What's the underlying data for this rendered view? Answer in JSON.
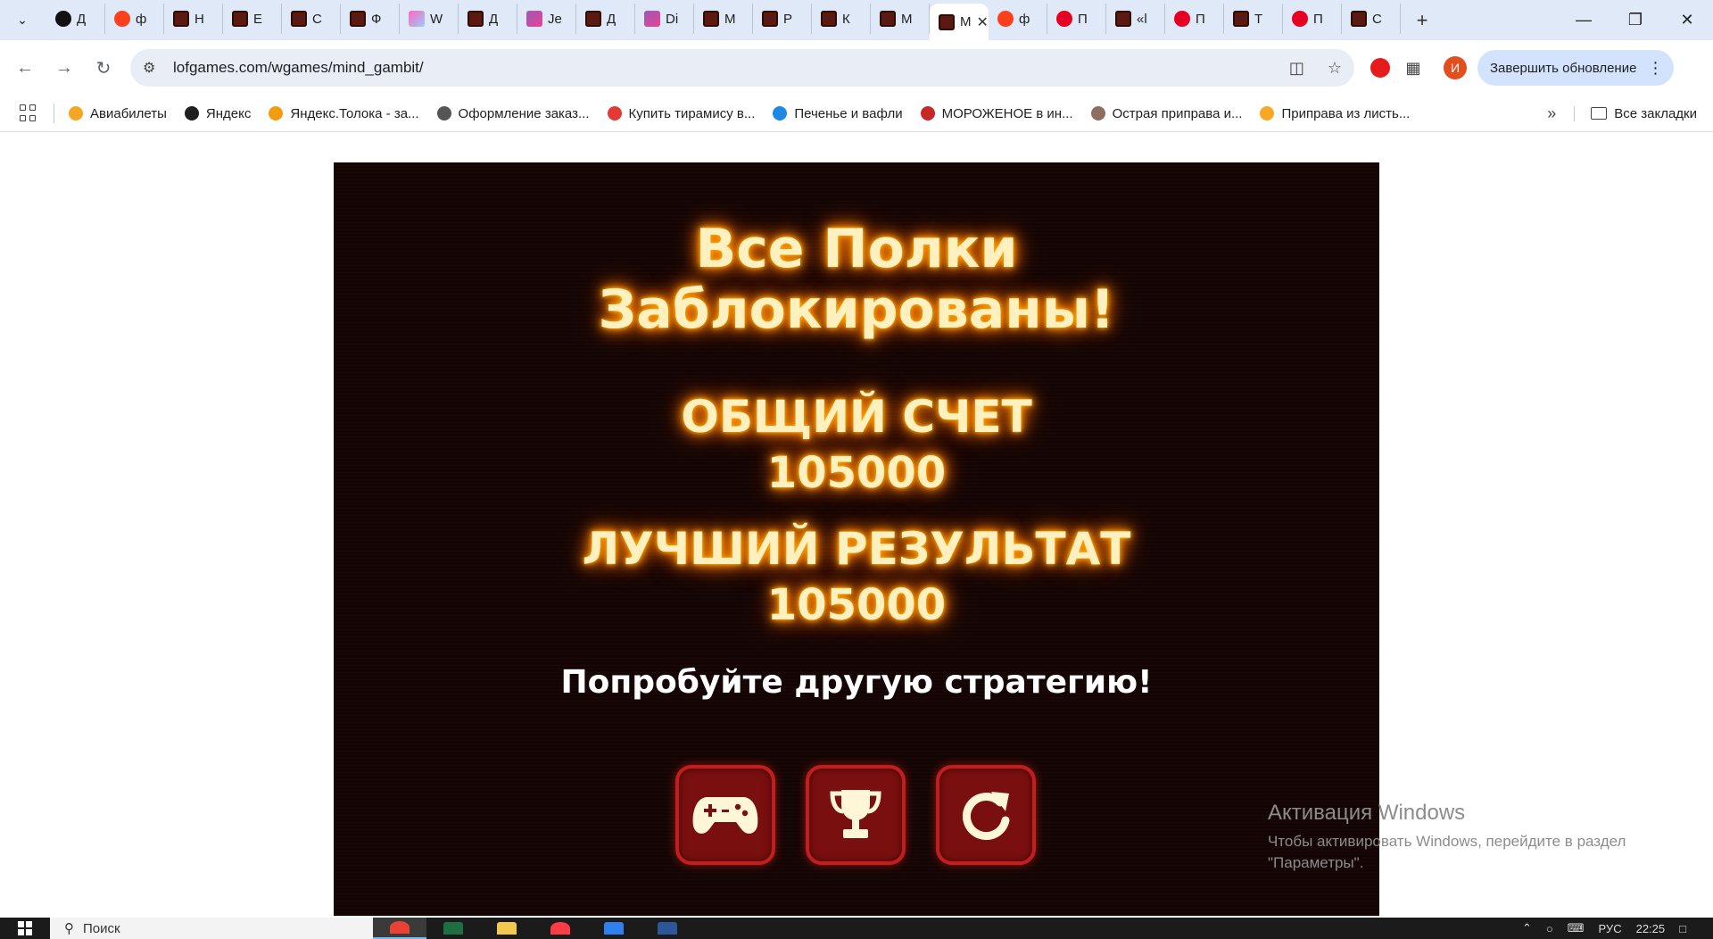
{
  "browser": {
    "tabs": [
      {
        "label": "Д",
        "favicon": "yandex-dark-icon"
      },
      {
        "label": "ф",
        "favicon": "yandex-icon"
      },
      {
        "label": "Н",
        "favicon": "game-icon"
      },
      {
        "label": "Е",
        "favicon": "game-icon"
      },
      {
        "label": "С",
        "favicon": "game-icon"
      },
      {
        "label": "Ф",
        "favicon": "game-icon"
      },
      {
        "label": "W",
        "favicon": "colorful-icon"
      },
      {
        "label": "Д",
        "favicon": "game-icon"
      },
      {
        "label": "Je",
        "favicon": "purple-icon"
      },
      {
        "label": "Д",
        "favicon": "game-icon"
      },
      {
        "label": "Di",
        "favicon": "purple-icon"
      },
      {
        "label": "М",
        "favicon": "game-icon"
      },
      {
        "label": "Р",
        "favicon": "game-icon"
      },
      {
        "label": "К",
        "favicon": "game-icon"
      },
      {
        "label": "М",
        "favicon": "game-icon"
      },
      {
        "label": "М",
        "favicon": "game-icon",
        "active": true
      },
      {
        "label": "ф",
        "favicon": "yandex-icon"
      },
      {
        "label": "П",
        "favicon": "pinterest-icon"
      },
      {
        "label": "«l",
        "favicon": "game-icon"
      },
      {
        "label": "П",
        "favicon": "pinterest-icon"
      },
      {
        "label": "Т",
        "favicon": "game-icon"
      },
      {
        "label": "П",
        "favicon": "pinterest-icon"
      },
      {
        "label": "С",
        "favicon": "game-icon"
      }
    ],
    "url": "lofgames.com/wgames/mind_gambit/",
    "update_button": "Завершить обновление",
    "avatar_letter": "И",
    "bookmarks": [
      {
        "label": "Авиабилеты",
        "color": "#f5a623"
      },
      {
        "label": "Яндекс",
        "color": "#1f1f1f"
      },
      {
        "label": "Яндекс.Толока - за...",
        "color": "#f39c12"
      },
      {
        "label": "Оформление заказ...",
        "color": "#555555"
      },
      {
        "label": "Купить тирамису в...",
        "color": "#e53935"
      },
      {
        "label": "Печенье и вафли",
        "color": "#1e88e5"
      },
      {
        "label": "МОРОЖЕНОЕ в ин...",
        "color": "#c62828"
      },
      {
        "label": "Острая приправа и...",
        "color": "#8d6e63"
      },
      {
        "label": "Приправа из листь...",
        "color": "#f9a825"
      }
    ],
    "all_bookmarks": "Все закладки"
  },
  "game": {
    "title_line1": "Все Полки",
    "title_line2": "Заблокированы!",
    "score_label": "ОБЩИЙ СЧЕТ",
    "score_value": "105000",
    "best_label": "ЛУЧШИЙ РЕЗУЛЬТАТ",
    "best_value": "105000",
    "message": "Попробуйте другую стратегию!",
    "buttons": [
      "gamepad-icon",
      "trophy-icon",
      "restart-icon"
    ]
  },
  "watermark": {
    "title": "Активация Windows",
    "text": "Чтобы активировать Windows, перейдите в раздел \"Параметры\"."
  },
  "taskbar": {
    "search_placeholder": "Поиск",
    "lang": "РУС",
    "time": "22:25"
  }
}
